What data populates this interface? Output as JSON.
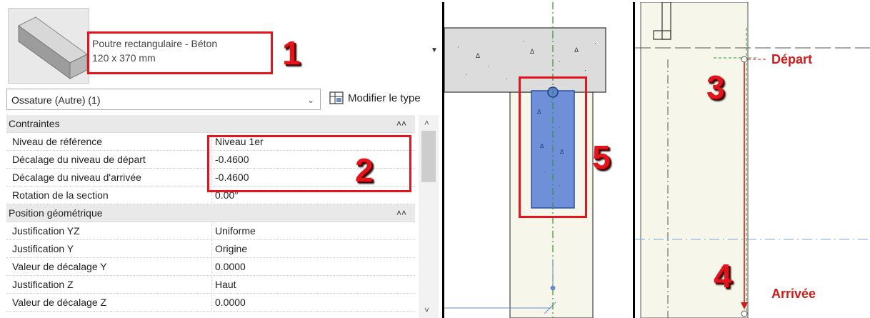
{
  "properties": {
    "type_selector": {
      "name_line1": "Poutre rectangulaire - Béton",
      "name_line2": "120 x 370 mm"
    },
    "filter": "Ossature (Autre) (1)",
    "edit_type": "Modifier le type",
    "groups": [
      {
        "name": "Contraintes",
        "rows": [
          {
            "label": "Niveau de référence",
            "value": "Niveau 1er"
          },
          {
            "label": "Décalage du niveau de départ",
            "value": "-0.4600"
          },
          {
            "label": "Décalage du niveau d'arrivée",
            "value": "-0.4600"
          },
          {
            "label": "Rotation de la section",
            "value": "0.00°"
          }
        ]
      },
      {
        "name": "Position géométrique",
        "rows": [
          {
            "label": "Justification YZ",
            "value": "Uniforme"
          },
          {
            "label": "Justification Y",
            "value": "Origine"
          },
          {
            "label": "Valeur de décalage Y",
            "value": "0.0000"
          },
          {
            "label": "Justification Z",
            "value": "Haut"
          },
          {
            "label": "Valeur de décalage Z",
            "value": "0.0000"
          }
        ]
      }
    ]
  },
  "callouts": [
    "1",
    "2",
    "3",
    "4",
    "5"
  ],
  "elevation": {
    "start_label": "Départ",
    "end_label": "Arrivée"
  },
  "colors": {
    "callout": "#e3141b",
    "beam_fill": "#6f8fd9",
    "grid_green": "#2a9a2a",
    "elev_red": "#d11a1a"
  },
  "icons": [
    "edit-type-icon",
    "dropdown-arrow-icon",
    "chevron-down-icon",
    "collapse-icon",
    "scroll-up-icon",
    "scroll-down-icon"
  ]
}
